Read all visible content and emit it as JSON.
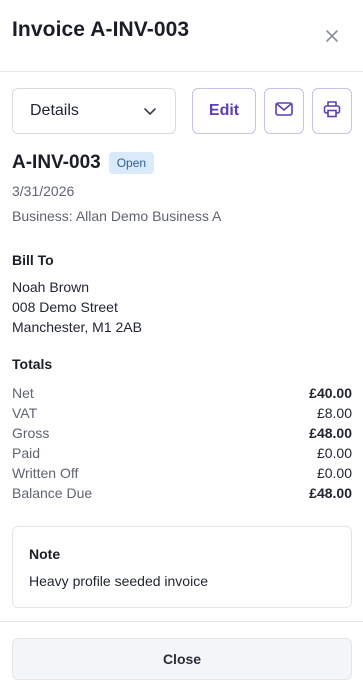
{
  "header": {
    "title": "Invoice A-INV-003",
    "close_icon": "close-icon"
  },
  "toolbar": {
    "view_select": {
      "selected": "Details",
      "icon": "chevron-down-icon"
    },
    "edit_label": "Edit",
    "email_icon": "mail-icon",
    "print_icon": "printer-icon"
  },
  "invoice": {
    "number": "A-INV-003",
    "status": "Open",
    "date": "3/31/2026",
    "business": "Business: Allan Demo Business A"
  },
  "bill_to": {
    "label": "Bill To",
    "name": "Noah Brown",
    "street": "008 Demo Street",
    "city": "Manchester, M1 2AB"
  },
  "totals": {
    "label": "Totals",
    "rows": [
      {
        "label": "Net",
        "value": "£40.00",
        "bold": true
      },
      {
        "label": "VAT",
        "value": "£8.00",
        "bold": false
      },
      {
        "label": "Gross",
        "value": "£48.00",
        "bold": true
      },
      {
        "label": "Paid",
        "value": "£0.00",
        "bold": false
      },
      {
        "label": "Written Off",
        "value": "£0.00",
        "bold": false
      },
      {
        "label": "Balance Due",
        "value": "£48.00",
        "bold": true
      }
    ]
  },
  "note": {
    "title": "Note",
    "text": "Heavy profile seeded invoice"
  },
  "footer": {
    "close_label": "Close"
  },
  "colors": {
    "accent": "#5b3fb3",
    "badge_bg": "#dbeafb",
    "badge_text": "#2a5f9e"
  }
}
